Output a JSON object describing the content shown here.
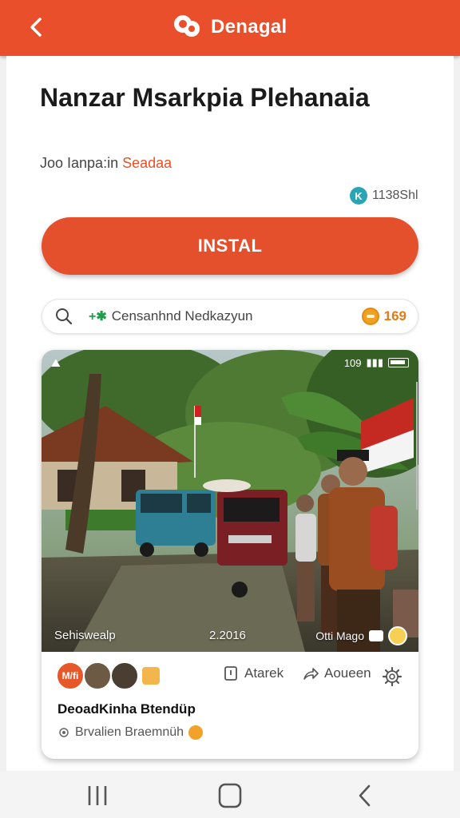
{
  "header": {
    "title": "Denagal",
    "back_icon": "chevron-left-icon",
    "logo_icon": "brand-logo-icon",
    "bg_color": "#e84f2a"
  },
  "app": {
    "title": "Nanzar Msarkpia Plehanaia",
    "developer_prefix": "Joo Ianpa:in",
    "developer_accent": "Seadaa",
    "rating_badge": "K",
    "rating_text": "1138Shl",
    "install_label": "INSTAL"
  },
  "search": {
    "mark": "+✱",
    "text": "Censanhnd Nedkazyun",
    "count": "169"
  },
  "card": {
    "photo_status": "109",
    "caption_left": "Sehiswealp",
    "caption_mid": "2.2016",
    "caption_right": "Otti Mago",
    "avatar_label": "M/fi",
    "action_1": "Atarek",
    "action_2": "Aoueen",
    "title": "DeoadKinha Btendüp",
    "subtitle": "Brvalien Braemnüh"
  },
  "navbar": {
    "recents_icon": "recents-icon",
    "home_icon": "home-icon",
    "back_icon": "back-icon"
  }
}
